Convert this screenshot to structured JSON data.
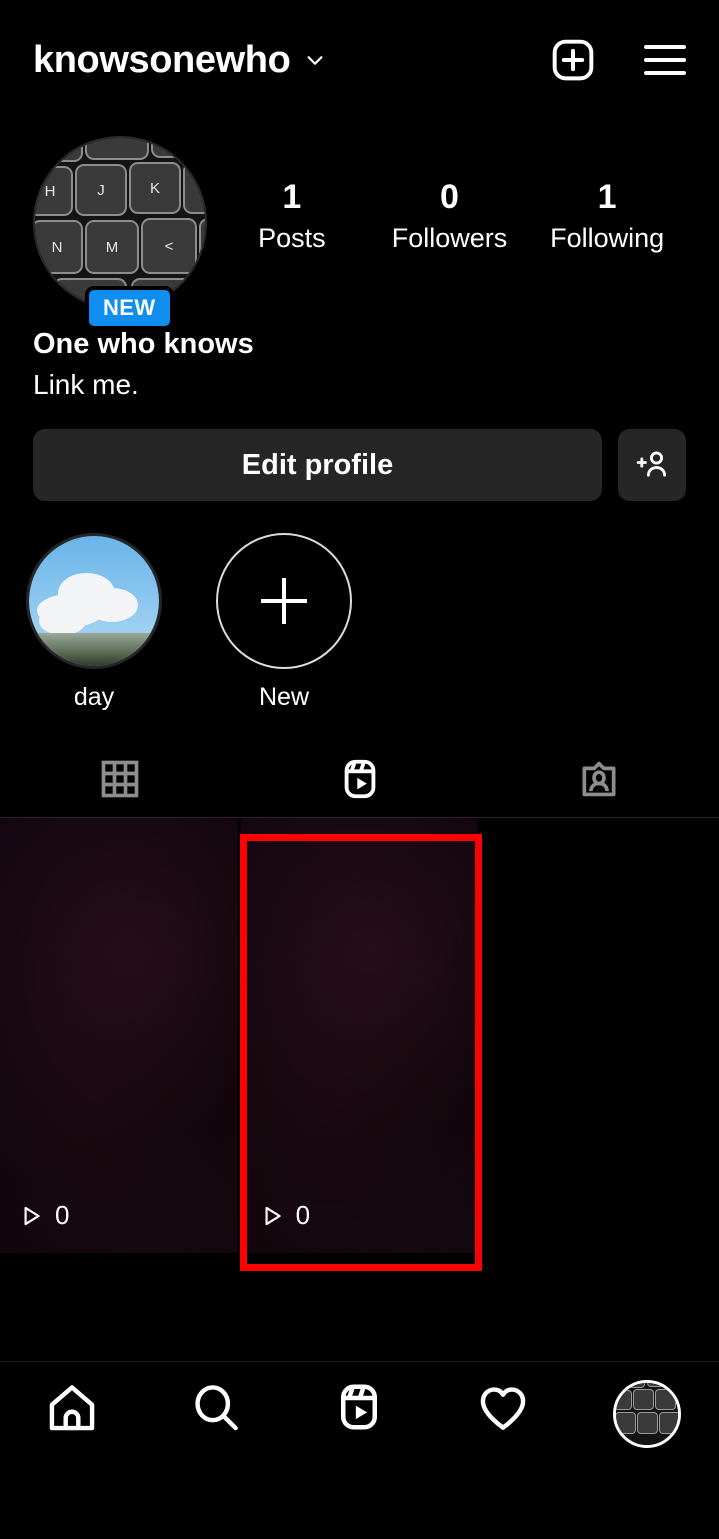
{
  "app": "instagram-profile",
  "theme": {
    "background": "#000000",
    "surface": "#262626",
    "accent": "#0f8ef0",
    "highlight": "#ff0000",
    "text": "#ffffff"
  },
  "header": {
    "username": "knowsonewho",
    "chevron_icon": "chevron-down-icon",
    "create_icon": "plus-square-icon",
    "menu_icon": "hamburger-menu-icon"
  },
  "profile": {
    "avatar_icon": "keyboard-avatar",
    "avatar_keys": [
      "H",
      "J",
      "K",
      "N",
      "M",
      "<"
    ],
    "new_badge": "NEW",
    "display_name": "One who knows",
    "bio": "Link me.",
    "stats": [
      {
        "value": "1",
        "label": "Posts"
      },
      {
        "value": "0",
        "label": "Followers"
      },
      {
        "value": "1",
        "label": "Following"
      }
    ]
  },
  "actions": {
    "edit_profile_label": "Edit profile",
    "add_user_icon": "person-add-icon"
  },
  "highlights": [
    {
      "label": "day",
      "icon": "sky-clouds-thumbnail"
    },
    {
      "label": "New",
      "icon": "plus-icon"
    }
  ],
  "tabs": [
    {
      "name": "grid",
      "icon": "grid-icon",
      "active": false
    },
    {
      "name": "reels",
      "icon": "reels-icon",
      "active": true
    },
    {
      "name": "tagged",
      "icon": "tagged-person-icon",
      "active": false
    }
  ],
  "reels": [
    {
      "plays": "0",
      "play_icon": "play-triangle-icon"
    },
    {
      "plays": "0",
      "play_icon": "play-triangle-icon"
    }
  ],
  "bottom_nav": [
    {
      "name": "home",
      "icon": "home-icon"
    },
    {
      "name": "search",
      "icon": "search-icon"
    },
    {
      "name": "reels",
      "icon": "reels-icon"
    },
    {
      "name": "activity",
      "icon": "heart-icon"
    },
    {
      "name": "profile",
      "icon": "profile-avatar-icon"
    }
  ]
}
